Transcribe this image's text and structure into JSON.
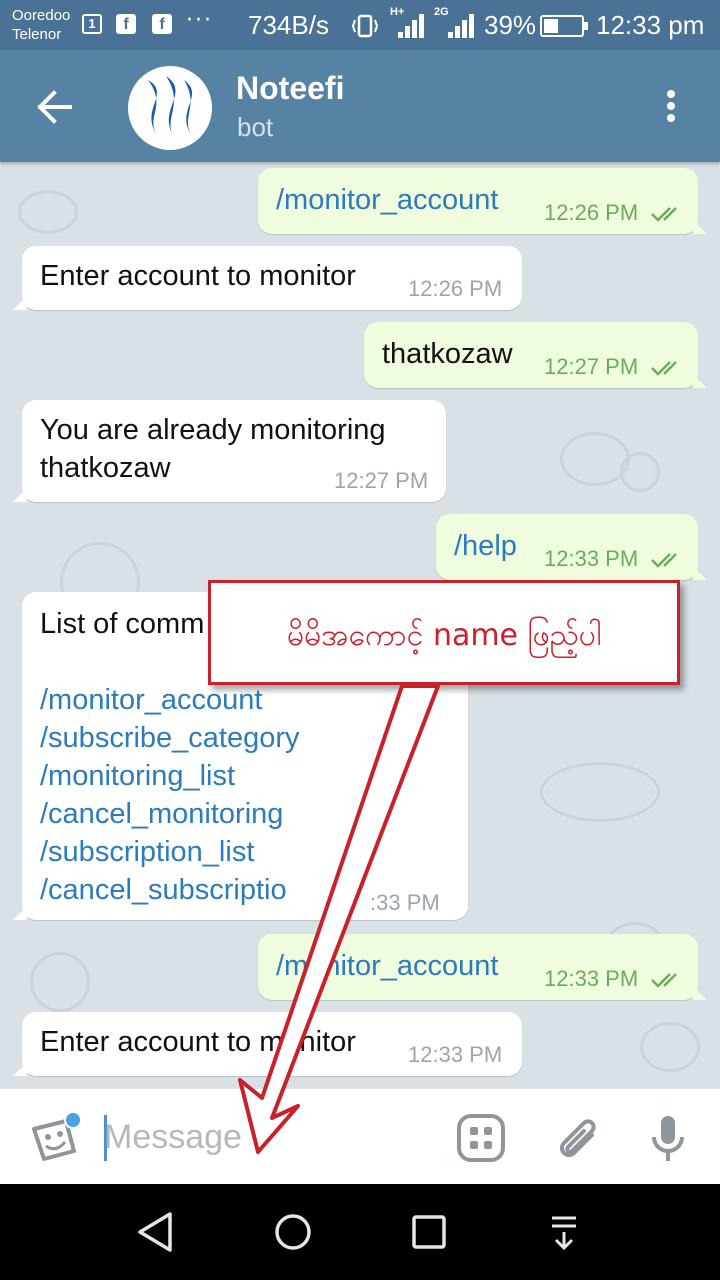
{
  "status_bar": {
    "carrier_1": "Ooredoo",
    "carrier_2": "Telenor",
    "sim_badge": "1",
    "fb_badge": "f",
    "speed": "734B/s",
    "net_1": "H+",
    "net_2": "2G",
    "battery_percent": "39%",
    "battery_level": 0.39,
    "time": "12:33 pm"
  },
  "header": {
    "name": "Noteefi",
    "subtitle": "bot"
  },
  "messages": [
    {
      "side": "out",
      "text": "/monitor_account",
      "time": "12:26 PM"
    },
    {
      "side": "in",
      "text": "Enter account to monitor",
      "time": "12:26 PM"
    },
    {
      "side": "out",
      "text": "thatkozaw",
      "time": "12:27 PM"
    },
    {
      "side": "in",
      "line1": "You are already monitoring",
      "line2": "thatkozaw",
      "time": "12:27 PM"
    },
    {
      "side": "out",
      "text": "/help",
      "time": "12:33 PM"
    },
    {
      "side": "in",
      "heading": "List of comm",
      "commands": [
        "/monitor_account",
        "/subscribe_category",
        "/monitoring_list",
        "/cancel_monitoring",
        "/subscription_list",
        "/cancel_subscriptio"
      ],
      "time": ":33 PM"
    },
    {
      "side": "out",
      "text": "/monitor_account",
      "time": "12:33 PM"
    },
    {
      "side": "in",
      "text": "Enter account to monitor",
      "time": "12:33 PM"
    }
  ],
  "annotation": {
    "text": "မိမိအကောင့် name ဖြည့်ပါ",
    "color": "#c9202a"
  },
  "input": {
    "placeholder": "Message"
  },
  "colors": {
    "header": "#5682a3",
    "status_bar": "#4a7296",
    "chat_background": "#d9e1e6",
    "outgoing_bubble": "#effdde",
    "link": "#2b7bbd"
  }
}
